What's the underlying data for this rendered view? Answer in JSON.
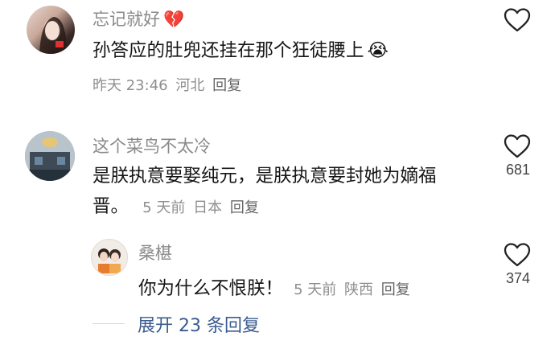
{
  "comments": [
    {
      "name": "忘记就好",
      "name_emoji": "💔",
      "text": "孙答应的肚兜还挂在那个狂徒腰上",
      "text_emoji": "😭",
      "time": "昨天 23:46",
      "location": "河北",
      "reply_label": "回复",
      "likes": ""
    },
    {
      "name": "这个菜鸟不太冷",
      "text_line1": "是朕执意要娶纯元，是朕执意要封她为嫡福",
      "text_line2": "晋。",
      "time": "5 天前",
      "location": "日本",
      "reply_label": "回复",
      "likes": "681"
    },
    {
      "name": "桑椹",
      "text": "你为什么不恨朕！",
      "time": "5 天前",
      "location": "陕西",
      "reply_label": "回复",
      "likes": "374"
    }
  ],
  "expand_replies": "展开 23 条回复",
  "colors": {
    "name": "#8a8a8a",
    "text": "#161616",
    "meta": "#8e8e8e",
    "expand": "#3b5b8f",
    "heart_outline": "#222222"
  }
}
